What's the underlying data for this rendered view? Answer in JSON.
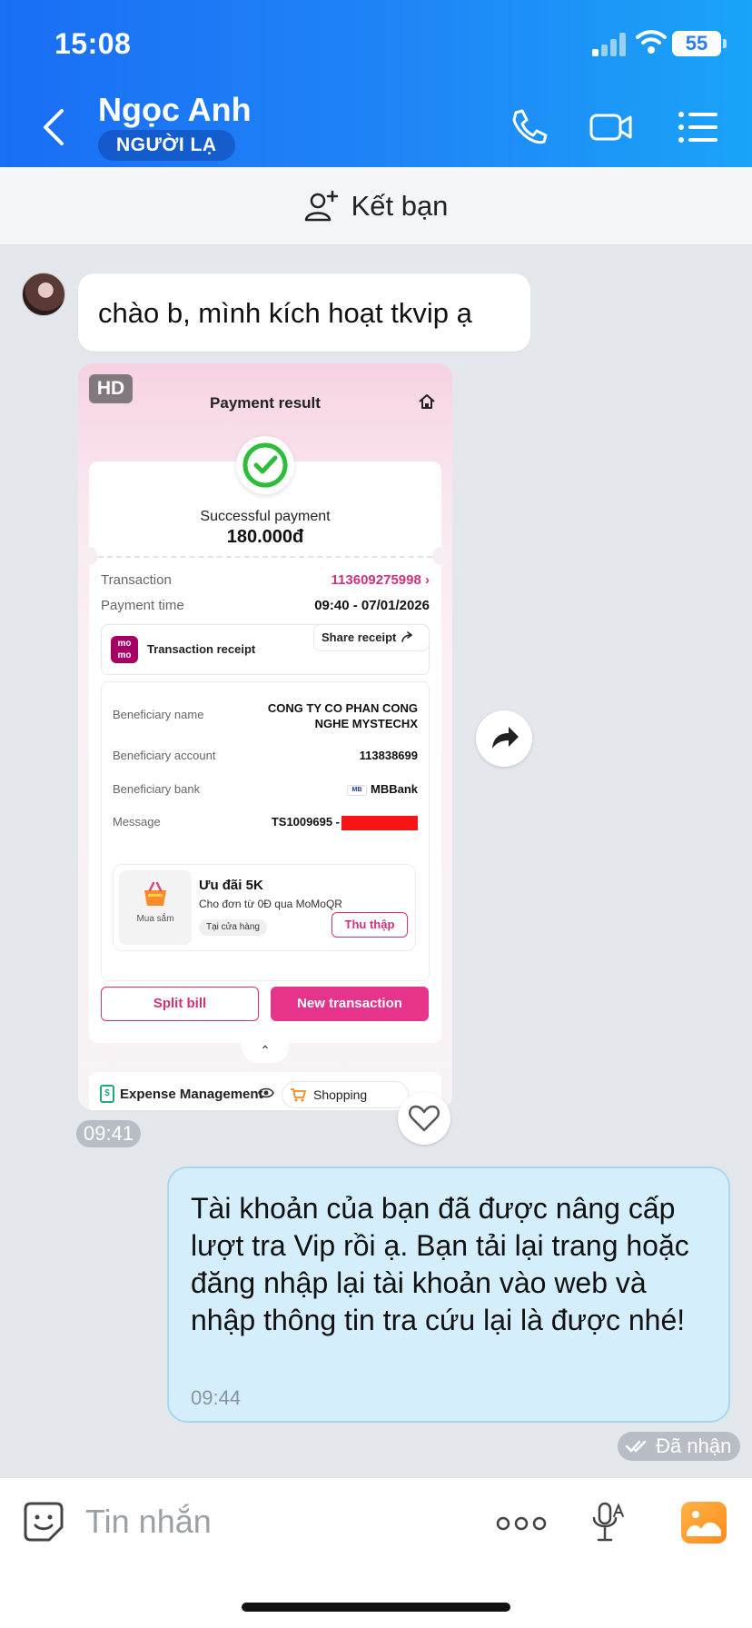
{
  "status_bar": {
    "time": "15:08",
    "battery": "55"
  },
  "header": {
    "contact_name": "Ngọc Anh",
    "contact_tag": "NGƯỜI LẠ"
  },
  "add_friend": {
    "label": "Kết bạn"
  },
  "messages": {
    "incoming_text": "chào b, mình kích hoạt tkvip ạ",
    "incoming_image_time": "09:41",
    "outgoing_text": "Tài khoản của bạn đã được nâng cấp lượt tra Vip rồi ạ. Bạn tải lại trang hoặc đăng nhập lại tài khoản vào web và nhập thông tin tra cứu lại là được nhé!",
    "outgoing_time": "09:44",
    "status": "Đã nhận"
  },
  "receipt": {
    "hd": "HD",
    "title": "Payment result",
    "success_label": "Successful payment",
    "amount": "180.000đ",
    "transaction_label": "Transaction",
    "transaction_value": "113609275998",
    "payment_time_label": "Payment time",
    "payment_time_value": "09:40 - 07/01/2026",
    "momo_logo": "mo mo",
    "receipt_label": "Transaction receipt",
    "share_label": "Share receipt",
    "beneficiary_name_label": "Beneficiary name",
    "beneficiary_name_line1": "CONG TY CO PHAN CONG",
    "beneficiary_name_line2": "NGHE MYSTECHX",
    "beneficiary_account_label": "Beneficiary account",
    "beneficiary_account_value": "113838699",
    "beneficiary_bank_label": "Beneficiary bank",
    "bank_chip": "MB",
    "beneficiary_bank_value": "MBBank",
    "message_label": "Message",
    "message_value": "TS1009695 -",
    "voucher_category": "Mua sắm",
    "voucher_title": "Ưu đãi 5K",
    "voucher_sub": "Cho đơn từ 0Đ qua MoMoQR",
    "voucher_tag": "Tại cửa hàng",
    "voucher_button": "Thu thập",
    "split_bill": "Split bill",
    "new_transaction": "New transaction",
    "caret": "⌃",
    "expense_icon": "$",
    "expense_label": "Expense Management",
    "shopping_label": "Shopping"
  },
  "input_bar": {
    "placeholder": "Tin nhắn"
  },
  "colors": {
    "header_blue": "#1f86f6",
    "momo_pink": "#d1317a",
    "outgoing_bubble": "#d4eefc"
  }
}
